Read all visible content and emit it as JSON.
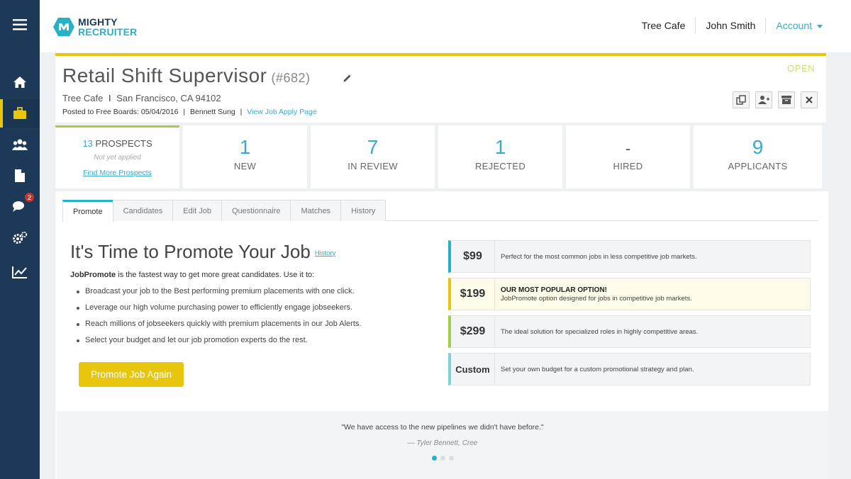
{
  "brand": {
    "line1": "MIGHTY",
    "line2": "RECRUITER"
  },
  "sidebar": {
    "items": [
      {
        "icon": "menu-icon"
      },
      {
        "icon": "home-icon"
      },
      {
        "icon": "briefcase-icon",
        "active": true
      },
      {
        "icon": "users-icon"
      },
      {
        "icon": "document-icon"
      },
      {
        "icon": "chat-icon",
        "badge": "2"
      },
      {
        "icon": "settings-icon"
      },
      {
        "icon": "chart-icon"
      }
    ]
  },
  "topnav": {
    "company": "Tree Cafe",
    "user": "John Smith",
    "account": "Account"
  },
  "job": {
    "title": "Retail Shift Supervisor",
    "number": "(#682)",
    "status": "OPEN",
    "company": "Tree Cafe",
    "location": "San Francisco, CA 94102",
    "posted": "Posted to Free Boards: 05/04/2016",
    "poster": "Bennett Sung",
    "view_link": "View Job Apply Page"
  },
  "stats": {
    "prospects": {
      "count": "13",
      "label": "PROSPECTS",
      "sub": "Not yet applied",
      "link": "Find More Prospects"
    },
    "cards": [
      {
        "value": "1",
        "label": "NEW"
      },
      {
        "value": "7",
        "label": "IN REVIEW"
      },
      {
        "value": "1",
        "label": "REJECTED"
      },
      {
        "value": "-",
        "label": "HIRED"
      },
      {
        "value": "9",
        "label": "APPLICANTS"
      }
    ]
  },
  "tabs": [
    "Promote",
    "Candidates",
    "Edit Job",
    "Questionnaire",
    "Matches",
    "History"
  ],
  "promote": {
    "title": "It's Time to Promote Your Job",
    "history_link": "History",
    "intro_bold": "JobPromote",
    "intro_rest": " is the fastest way to get more great candidates. Use it to:",
    "bullets": [
      "Broadcast your job to the Best performing premium placements with one click.",
      "Leverage our high volume purchasing power to efficiently engage jobseekers.",
      "Reach millions of jobseekers quickly with premium placements in our Job Alerts.",
      "Select your budget and let our job promotion experts do the rest."
    ],
    "button": "Promote Job Again",
    "prices": [
      {
        "amount": "$99",
        "headline": "",
        "desc": "Perfect for the most common jobs in less competitive job markets."
      },
      {
        "amount": "$199",
        "headline": "OUR MOST POPULAR OPTION!",
        "desc": "JobPromote option designed for jobs in competitive job markets."
      },
      {
        "amount": "$299",
        "headline": "",
        "desc": "The ideal solution for specialized roles in highly competitive areas."
      },
      {
        "amount": "Custom",
        "headline": "",
        "desc": "Set your own budget for a custom promotional strategy and plan."
      }
    ]
  },
  "testimonial": {
    "quote": "\"We have access to the new pipelines we didn't have before.\"",
    "author": "— Tyler Bennett, Cree"
  },
  "colors": {
    "sidebar": "#1c3a57",
    "accent": "#27b1c9",
    "yellow": "#e9c60e",
    "green": "#a5cc47"
  }
}
